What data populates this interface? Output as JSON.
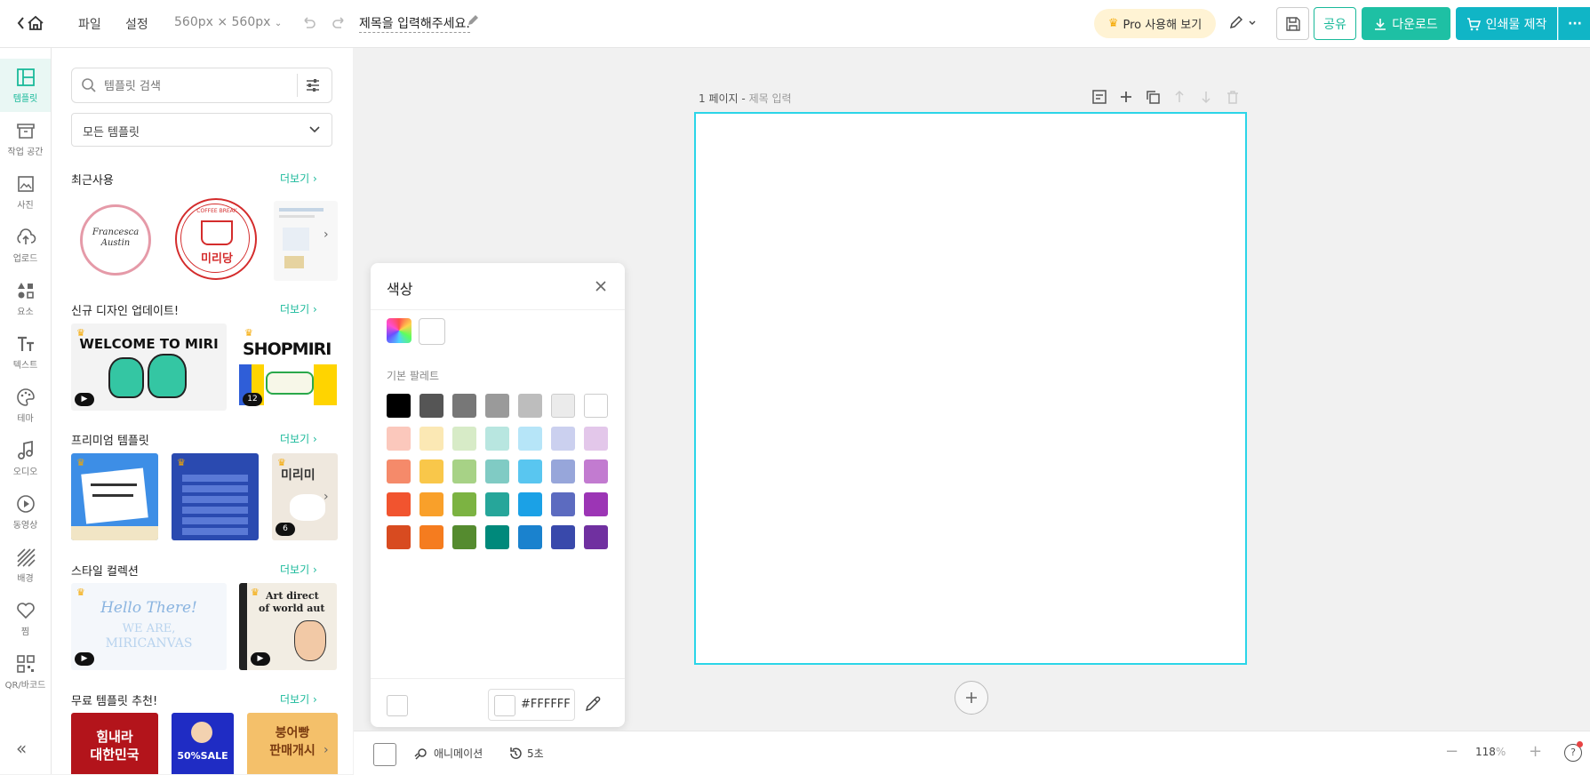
{
  "topbar": {
    "menu_file": "파일",
    "menu_settings": "설정",
    "size_label": "560px × 560px",
    "doc_title": "제목을 입력해주세요.",
    "pro_label": "Pro 사용해 보기",
    "share_label": "공유",
    "download_label": "다운로드",
    "print_label": "인쇄물 제작"
  },
  "rail": {
    "items": [
      {
        "label": "템플릿",
        "icon": "template-icon"
      },
      {
        "label": "작업 공간",
        "icon": "archive-icon"
      },
      {
        "label": "사진",
        "icon": "photo-icon"
      },
      {
        "label": "업로드",
        "icon": "upload-icon"
      },
      {
        "label": "요소",
        "icon": "elements-icon"
      },
      {
        "label": "텍스트",
        "icon": "text-icon"
      },
      {
        "label": "테마",
        "icon": "palette-icon"
      },
      {
        "label": "오디오",
        "icon": "audio-icon"
      },
      {
        "label": "동영상",
        "icon": "video-icon"
      },
      {
        "label": "배경",
        "icon": "background-icon"
      },
      {
        "label": "찜",
        "icon": "heart-icon"
      },
      {
        "label": "QR/바코드",
        "icon": "qr-icon"
      }
    ]
  },
  "panel": {
    "search_placeholder": "템플릿 검색",
    "filter_selected": "모든 템플릿",
    "more_label": "더보기",
    "sections": [
      {
        "title": "최근사용"
      },
      {
        "title": "신규 디자인 업데이트!"
      },
      {
        "title": "프리미엄 템플릿"
      },
      {
        "title": "스타일 컬렉션"
      },
      {
        "title": "무료 템플릿 추천!"
      }
    ],
    "thumb_texts": {
      "recent1_line1": "Francesca",
      "recent1_line2": "Austin",
      "recent2_top": "COFFEE BREAK",
      "recent2_bottom": "미리당",
      "new1": "WELCOME TO MIRI",
      "new2": "SHOPMIRI",
      "new2_badge": "12",
      "premium3_title": "미리미",
      "premium3_badge": "6",
      "style1_line1": "Hello There!",
      "style1_line2": "WE ARE,",
      "style1_line3": "MIRICANVAS",
      "style2_line1": "Art direct",
      "style2_line2": "of world aut",
      "free1_line1": "힘내라",
      "free1_line2": "대한민국",
      "free2": "50%SALE",
      "free3_line1": "붕어빵",
      "free3_line2": "판매개시"
    }
  },
  "canvas": {
    "page_label": "1 페이지",
    "page_title_placeholder": "제목 입력"
  },
  "color_popup": {
    "title": "색상",
    "palette_label": "기본 팔레트",
    "hex_value": "#FFFFFF",
    "palette": [
      [
        "#000000",
        "#555555",
        "#777777",
        "#9a9a9a",
        "#bdbdbd",
        "#ebebeb",
        "#ffffff"
      ],
      [
        "#fbc8bc",
        "#fbe8b4",
        "#d7ebc7",
        "#b8e6e0",
        "#b6e5f8",
        "#cbd0ef",
        "#e3c7ea"
      ],
      [
        "#f58a6a",
        "#f9c74a",
        "#a7d286",
        "#80cbc4",
        "#59c6f0",
        "#97a6da",
        "#c27bd0"
      ],
      [
        "#f1542f",
        "#f9a02a",
        "#7cb342",
        "#26a69a",
        "#1ba1e6",
        "#5c6bc0",
        "#9c35b5"
      ],
      [
        "#d84b20",
        "#f57c1f",
        "#558b2f",
        "#00897b",
        "#1a82ce",
        "#3949ab",
        "#7030a0"
      ]
    ]
  },
  "bottombar": {
    "animation_label": "애니메이션",
    "history_label": "5초",
    "zoom_value": "118",
    "zoom_unit": "%"
  },
  "colors": {
    "accent": "#19b99a",
    "canvas_border": "#2bd5e8",
    "print_button": "#10b5c6"
  }
}
